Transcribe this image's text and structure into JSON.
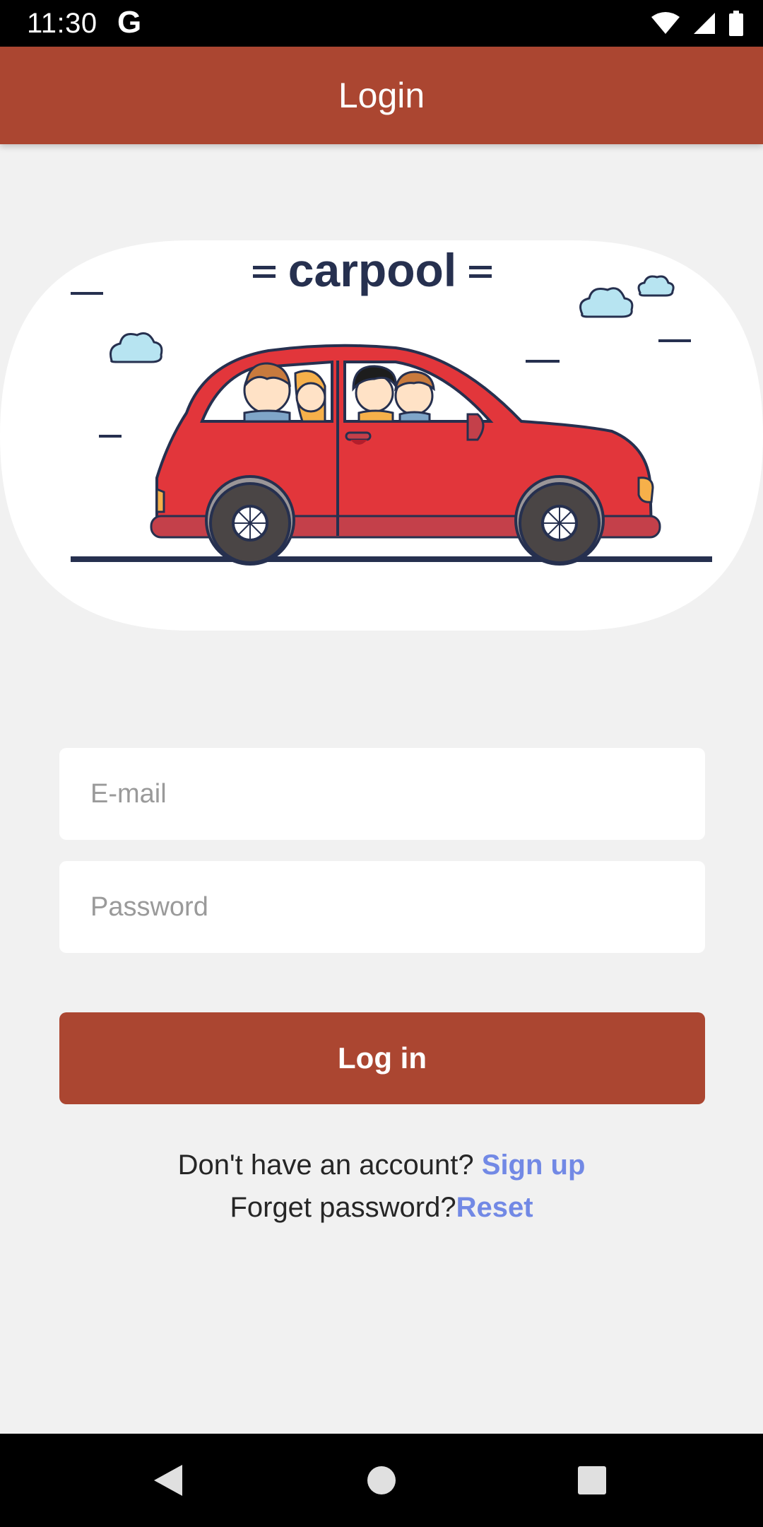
{
  "status_bar": {
    "time": "11:30",
    "google_badge": "G",
    "icons": [
      "wifi-icon",
      "cell-signal-icon",
      "battery-icon"
    ]
  },
  "app_bar": {
    "title": "Login"
  },
  "hero": {
    "logo_text": "carpool"
  },
  "form": {
    "email_placeholder": "E-mail",
    "password_placeholder": "Password",
    "login_label": "Log in"
  },
  "footer_links": {
    "signup_prompt": "Don't have an account?",
    "signup_link": "Sign up",
    "reset_prompt": "Forget password?",
    "reset_link": "Reset"
  },
  "colors": {
    "primary": "#ab4631",
    "link": "#7289e5",
    "background": "#f1f1f1"
  }
}
